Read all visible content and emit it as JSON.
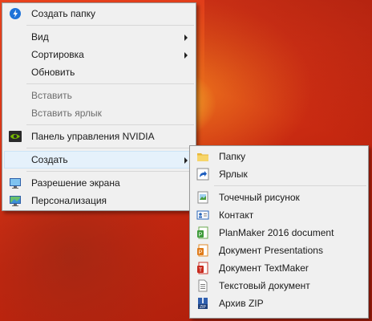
{
  "context_menu": {
    "items": [
      {
        "label": "Создать папку"
      },
      {
        "label": "Вид"
      },
      {
        "label": "Сортировка"
      },
      {
        "label": "Обновить"
      },
      {
        "label": "Вставить"
      },
      {
        "label": "Вставить ярлык"
      },
      {
        "label": "Панель управления NVIDIA"
      },
      {
        "label": "Создать"
      },
      {
        "label": "Разрешение экрана"
      },
      {
        "label": "Персонализация"
      }
    ]
  },
  "create_submenu": {
    "items": [
      {
        "label": "Папку"
      },
      {
        "label": "Ярлык"
      },
      {
        "label": "Точечный рисунок"
      },
      {
        "label": "Контакт"
      },
      {
        "label": "PlanMaker 2016 document"
      },
      {
        "label": "Документ Presentations"
      },
      {
        "label": "Документ TextMaker"
      },
      {
        "label": "Текстовый документ"
      },
      {
        "label": "Архив ZIP"
      }
    ]
  },
  "icons": {
    "create_folder": "cortana-circle-icon",
    "nvidia": "nvidia-icon",
    "resolution": "monitor-icon",
    "personalize": "personalize-monitor-icon",
    "folder": "folder-icon",
    "shortcut": "shortcut-icon",
    "bitmap": "bitmap-icon",
    "contact": "contact-card-icon",
    "planmaker": "planmaker-icon",
    "presentations": "presentations-icon",
    "textmaker": "textmaker-icon",
    "text_document": "text-document-icon",
    "zip": "zip-archive-icon"
  },
  "colors": {
    "menu_background": "#f0f0f0",
    "highlight": "#e5f1fb",
    "desktop": "#d83517"
  }
}
